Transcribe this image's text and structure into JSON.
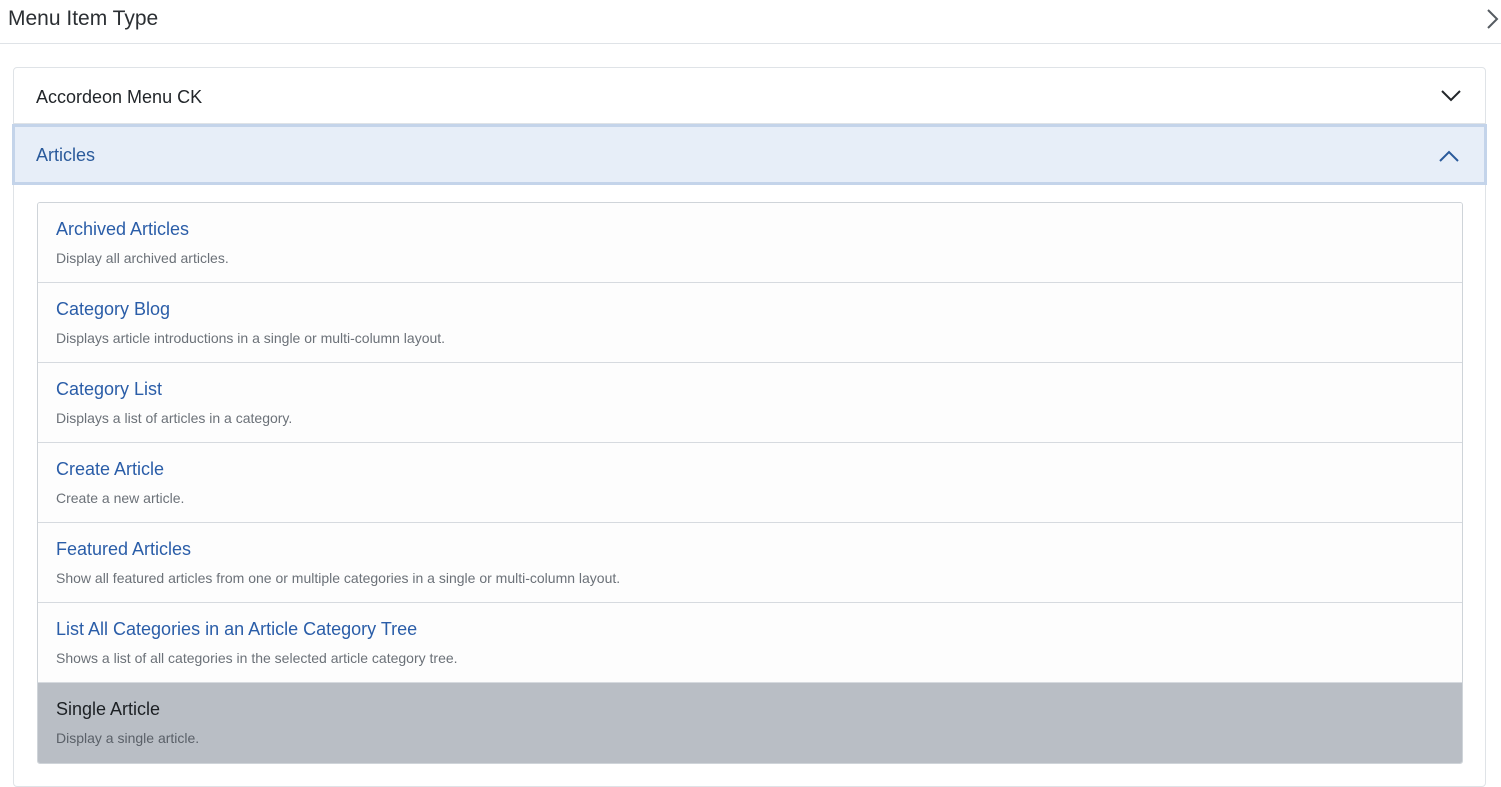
{
  "modal": {
    "title": "Menu Item Type",
    "close_icon": "chevron-right-icon"
  },
  "accordion": {
    "sections": [
      {
        "label": "Accordeon Menu CK",
        "state": "collapsed",
        "icon": "chevron-down-icon"
      },
      {
        "label": "Articles",
        "state": "expanded",
        "icon": "chevron-up-icon"
      }
    ]
  },
  "articles": {
    "items": [
      {
        "title": "Archived Articles",
        "description": "Display all archived articles."
      },
      {
        "title": "Category Blog",
        "description": "Displays article introductions in a single or multi-column layout."
      },
      {
        "title": "Category List",
        "description": "Displays a list of articles in a category."
      },
      {
        "title": "Create Article",
        "description": "Create a new article."
      },
      {
        "title": "Featured Articles",
        "description": "Show all featured articles from one or multiple categories in a single or multi-column layout."
      },
      {
        "title": "List All Categories in an Article Category Tree",
        "description": "Shows a list of all categories in the selected article category tree."
      },
      {
        "title": "Single Article",
        "description": "Display a single article.",
        "selected": true
      }
    ]
  },
  "colors": {
    "link": "#2a5da8",
    "active_header_bg": "#e7eef8",
    "selected_item_bg": "#b9bec5"
  }
}
